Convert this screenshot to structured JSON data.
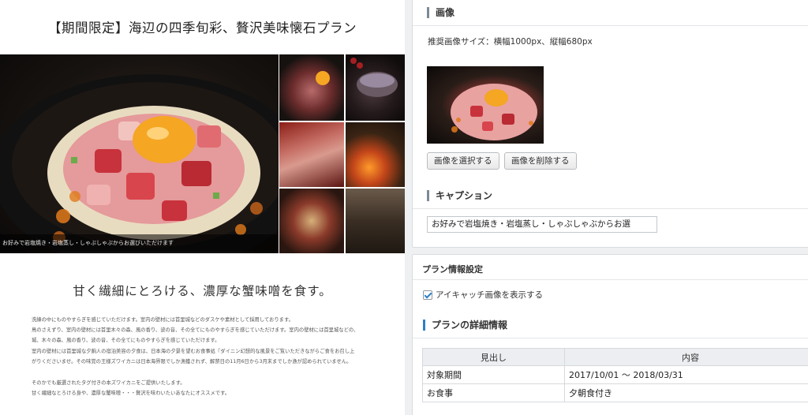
{
  "preview": {
    "title": "【期間限定】海辺の四季旬彩、贅沢美味懐石プラン",
    "photo_caption": "お好みで岩塩焼き・岩塩蒸し・しゃぶしゃぶからお選びいただけます",
    "subheading": "甘く繊細にとろける、濃厚な蟹味噌を食す。",
    "body": [
      "洗練の中にものやすらぎを感じていただけます。室内の壁材には首里城などのダスケや素材として採用しております。",
      "鳥のさえずり、室内の壁材には首里木々の森、風の香り、波の音、その全てにものやすらぎを感じていただけます。室内の壁材には首里城などの、",
      "城、木々の森、風の香り、波の音、その全てにものやすらぎを感じていただけます。",
      "室内の壁材には首里城な夕餉人の宿泊美容の夕食は、日本海の夕景を望むお食事処『ダイニン幻想的な風景をご覧いただきながらご食をお召し上",
      "がりくださいませ。その味覚の王様ズワイカニは日本海界限でしか漁獲されず、解禁日の11月6日から3月末までしか漁が認められていません。",
      "",
      "そのかでも厳選されたタグ付きの本ズワイカニをご提供いたします。",
      "甘く繊細なとろける身や、濃厚な蟹味噌・・・贅沢を味わいたいあなたにオススメです。"
    ]
  },
  "image_section": {
    "heading": "画像",
    "size_note": "推奨画像サイズ：横幅1000px、縦幅680px",
    "select_button": "画像を選択する",
    "delete_button": "画像を削除する"
  },
  "caption_section": {
    "heading": "キャプション",
    "value": "お好みで岩塩焼き・岩塩蒸し・しゃぶしゃぶからお選"
  },
  "plan_info": {
    "title": "プラン情報設定",
    "eyecatch_checkbox_label": "アイキャッチ画像を表示する",
    "eyecatch_checked": true,
    "details_heading": "プランの詳細情報",
    "table": {
      "headers": [
        "見出し",
        "内容"
      ],
      "rows": [
        [
          "対象期間",
          "2017/10/01 〜 2018/03/31"
        ],
        [
          "お食事",
          "夕朝食付き"
        ]
      ]
    }
  },
  "colors": {
    "accent": "#2d7fc1",
    "yolk": "#f5a623",
    "tuna": "#c8323c"
  }
}
